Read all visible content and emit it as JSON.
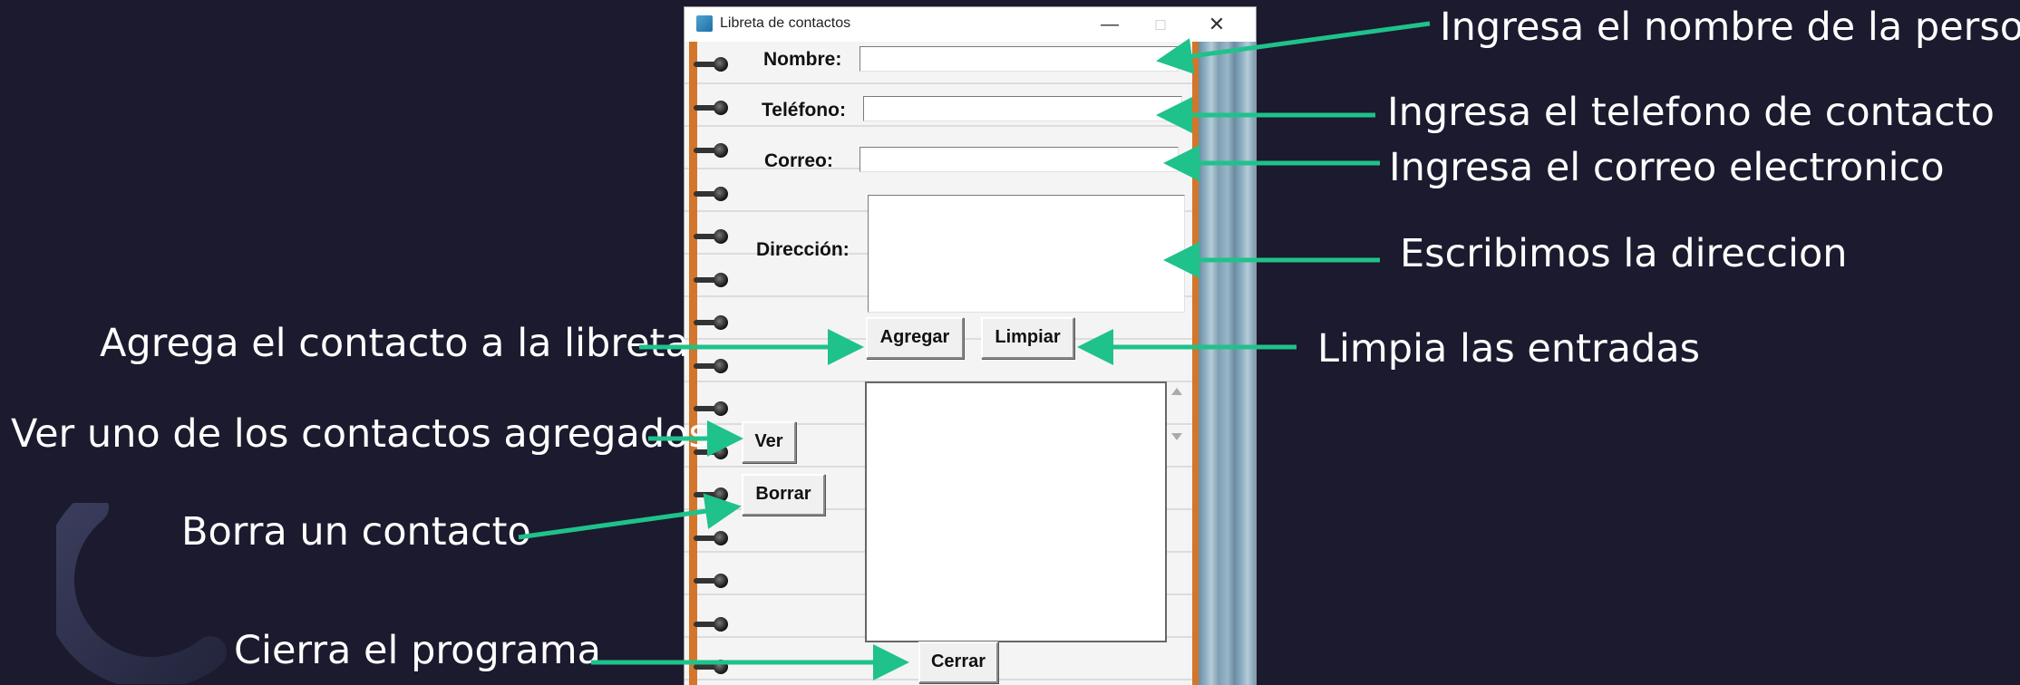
{
  "window": {
    "title": "Libreta de contactos",
    "minimize": "—",
    "maximize": "□",
    "close": "✕"
  },
  "form": {
    "nombre_label": "Nombre:",
    "telefono_label": "Teléfono:",
    "correo_label": "Correo:",
    "direccion_label": "Dirección:",
    "nombre_value": "",
    "telefono_value": "",
    "correo_value": "",
    "direccion_value": ""
  },
  "buttons": {
    "agregar": "Agregar",
    "limpiar": "Limpiar",
    "ver": "Ver",
    "borrar": "Borrar",
    "cerrar": "Cerrar"
  },
  "annotations": {
    "nombre": "Ingresa el nombre de la persona",
    "telefono": "Ingresa el telefono de contacto",
    "correo": "Ingresa el correo electronico",
    "direccion": "Escribimos la direccion",
    "limpiar": "Limpia las entradas",
    "agregar": "Agrega el contacto a la libreta",
    "ver": "Ver uno de los contactos agregados",
    "borrar": "Borra un contacto",
    "cerrar": "Cierra el programa"
  },
  "colors": {
    "background": "#1b1a2e",
    "arrow": "#1fc28a",
    "spine": "#d3762b"
  },
  "icons": {
    "app": "notebook-icon",
    "scroll_up": "scroll-up-icon",
    "scroll_down": "scroll-down-icon"
  }
}
